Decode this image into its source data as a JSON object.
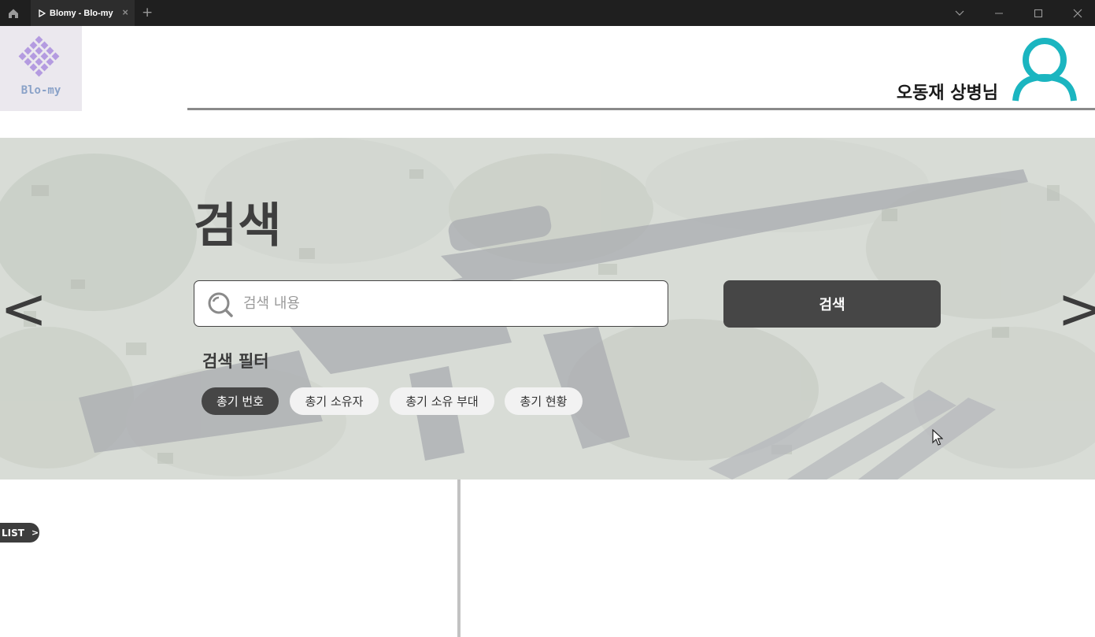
{
  "window": {
    "tab_title": "Blomy - Blo-my",
    "tab_close": "×",
    "tab_add": "+"
  },
  "header": {
    "logo_text": "Blo-my",
    "user_name": "오동재 상병님"
  },
  "hero": {
    "title": "검색",
    "search_placeholder": "검색 내용",
    "search_value": "",
    "search_button": "검색",
    "filter_label": "검색 필터",
    "filters": [
      {
        "label": "총기 번호",
        "active": true
      },
      {
        "label": "총기 소유자",
        "active": false
      },
      {
        "label": "총기 소유 부대",
        "active": false
      },
      {
        "label": "총기 현황",
        "active": false
      }
    ],
    "prev_arrow": "<",
    "next_arrow": ">"
  },
  "list_panel": {
    "label": "LIST",
    "chevron": ">"
  },
  "colors": {
    "accent": "#1bb5c0",
    "dark_button": "#464646",
    "logo_diamond": "#b49be0"
  },
  "icons": [
    "home-icon",
    "play-icon",
    "close-icon",
    "plus-icon",
    "chevron-down-icon",
    "minimize-icon",
    "maximize-icon",
    "window-close-icon",
    "logo-diamond-icon",
    "user-avatar-icon",
    "search-icon",
    "cursor-icon"
  ]
}
